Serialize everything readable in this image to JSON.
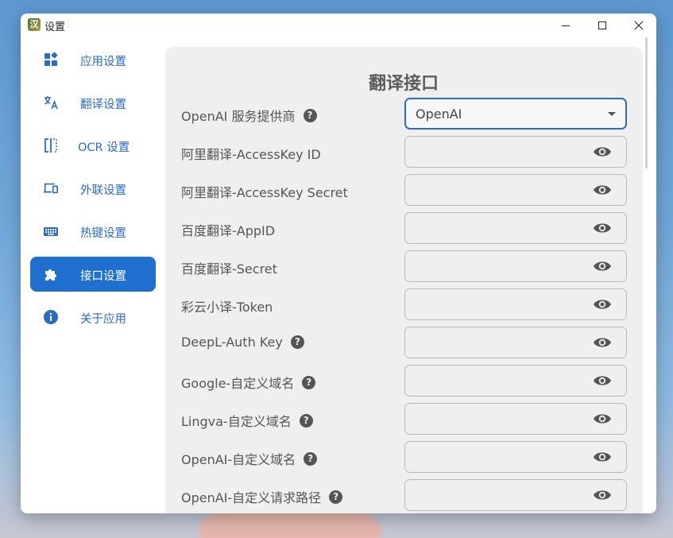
{
  "window": {
    "title": "设置",
    "app_icon_glyph": "汉"
  },
  "sidebar": {
    "items": [
      {
        "label": "应用设置",
        "icon": "apps-icon",
        "active": false
      },
      {
        "label": "翻译设置",
        "icon": "translate-icon",
        "active": false
      },
      {
        "label": "OCR 设置",
        "icon": "ocr-scan-icon",
        "active": false
      },
      {
        "label": "外联设置",
        "icon": "devices-icon",
        "active": false
      },
      {
        "label": "热键设置",
        "icon": "keyboard-icon",
        "active": false
      },
      {
        "label": "接口设置",
        "icon": "puzzle-icon",
        "active": true
      },
      {
        "label": "关于应用",
        "icon": "info-icon",
        "active": false
      }
    ]
  },
  "main": {
    "title": "翻译接口",
    "rows": [
      {
        "label": "OpenAI 服务提供商",
        "help": true,
        "type": "select",
        "value": "OpenAI"
      },
      {
        "label": "阿里翻译-AccessKey ID",
        "help": false,
        "type": "password",
        "value": ""
      },
      {
        "label": "阿里翻译-AccessKey Secret",
        "help": false,
        "type": "password",
        "value": ""
      },
      {
        "label": "百度翻译-AppID",
        "help": false,
        "type": "password",
        "value": ""
      },
      {
        "label": "百度翻译-Secret",
        "help": false,
        "type": "password",
        "value": ""
      },
      {
        "label": "彩云小译-Token",
        "help": false,
        "type": "password",
        "value": ""
      },
      {
        "label": "DeepL-Auth Key",
        "help": true,
        "type": "password",
        "value": ""
      },
      {
        "label": "Google-自定义域名",
        "help": true,
        "type": "password",
        "value": ""
      },
      {
        "label": "Lingva-自定义域名",
        "help": true,
        "type": "password",
        "value": ""
      },
      {
        "label": "OpenAI-自定义域名",
        "help": true,
        "type": "password",
        "value": ""
      },
      {
        "label": "OpenAI-自定义请求路径",
        "help": true,
        "type": "password",
        "value": ""
      }
    ]
  },
  "colors": {
    "accent": "#1f6fcf",
    "panel_bg": "#efefef",
    "label_text": "#555555"
  }
}
